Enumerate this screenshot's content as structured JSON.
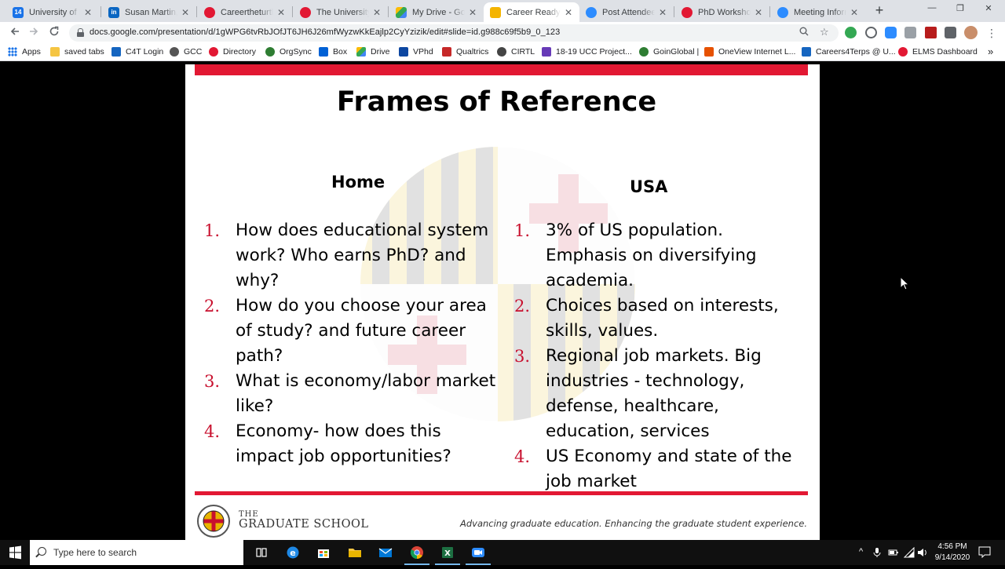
{
  "browser": {
    "tabs": [
      {
        "title": "University of Ma",
        "favicon_color": "#1a73e8",
        "favicon_text": "14"
      },
      {
        "title": "Susan Martin, Ed",
        "favicon_color": "#0a66c2",
        "favicon_text": "in"
      },
      {
        "title": "Careertheturtle",
        "favicon_color": "#e21833",
        "favicon_text": ""
      },
      {
        "title": "The University of",
        "favicon_color": "#e21833",
        "favicon_text": ""
      },
      {
        "title": "My Drive - Goog",
        "favicon_color": "#34a853",
        "favicon_text": ""
      },
      {
        "title": "Career Ready Ti",
        "favicon_color": "#f4b400",
        "favicon_text": ""
      },
      {
        "title": "Post Attendee -",
        "favicon_color": "#2d8cff",
        "favicon_text": ""
      },
      {
        "title": "PhD Workshop",
        "favicon_color": "#e21833",
        "favicon_text": ""
      },
      {
        "title": "Meeting Inform",
        "favicon_color": "#2d8cff",
        "favicon_text": ""
      }
    ],
    "active_tab_index": 5,
    "new_tab_label": "+",
    "window_controls": {
      "minimize": "—",
      "restore": "❐",
      "close": "✕"
    },
    "url": "docs.google.com/presentation/d/1gWPG6tvRbJOfJT6JH6J26mfWyzwKkEajlp2CyYzizik/edit#slide=id.g988c69f5b9_0_123",
    "bookmarks": [
      {
        "label": "Apps",
        "icon": "apps-grid-icon",
        "color": "#1a73e8"
      },
      {
        "label": "saved tabs",
        "icon": "folder-icon",
        "color": "#f5c542"
      },
      {
        "label": "C4T Login",
        "icon": "c4t-icon",
        "color": "#1565c0"
      },
      {
        "label": "GCC",
        "icon": "gcc-icon",
        "color": "#555555"
      },
      {
        "label": "Directory",
        "icon": "umd-icon",
        "color": "#e21833"
      },
      {
        "label": "OrgSync",
        "icon": "orgsync-icon",
        "color": "#2e7d32"
      },
      {
        "label": "Box",
        "icon": "box-icon",
        "color": "#0061d5"
      },
      {
        "label": "Drive",
        "icon": "drive-icon",
        "color": "#34a853"
      },
      {
        "label": "VPhd",
        "icon": "vphd-icon",
        "color": "#0d47a1"
      },
      {
        "label": "Qualtrics",
        "icon": "qualtrics-icon",
        "color": "#c62828"
      },
      {
        "label": "CIRTL",
        "icon": "cirtl-icon",
        "color": "#444444"
      },
      {
        "label": "18-19 UCC Project...",
        "icon": "forms-icon",
        "color": "#673ab7"
      },
      {
        "label": "GoinGlobal |",
        "icon": "goinglobal-icon",
        "color": "#2e7d32"
      },
      {
        "label": "OneView Internet L...",
        "icon": "oneview-icon",
        "color": "#e65100"
      },
      {
        "label": "Careers4Terps @ U...",
        "icon": "careers-icon",
        "color": "#1565c0"
      },
      {
        "label": "ELMS Dashboard",
        "icon": "elms-icon",
        "color": "#e21833"
      }
    ],
    "more_bookmarks": "»"
  },
  "slide": {
    "title": "Frames of Reference",
    "home": {
      "heading": "Home",
      "items": [
        {
          "num": "1.",
          "text": "How does educational system work? Who earns PhD? and why?"
        },
        {
          "num": "2.",
          "text": "How do you choose your area of study? and future career path?"
        },
        {
          "num": "3.",
          "text": "What is economy/labor market like?"
        },
        {
          "num": "4.",
          "text": "Economy- how does this impact job opportunities?"
        }
      ]
    },
    "usa": {
      "heading": "USA",
      "items": [
        {
          "num": "1.",
          "text": "3% of US population. Emphasis on diversifying academia."
        },
        {
          "num": "2.",
          "text": "Choices based on interests, skills, values."
        },
        {
          "num": "3.",
          "text": "Regional job markets. Big industries - technology, defense, healthcare, education, services"
        },
        {
          "num": "4.",
          "text": "US Economy and state of the job market"
        }
      ]
    },
    "footer": {
      "the": "THE",
      "school": "GRADUATE SCHOOL",
      "tagline": "Advancing graduate education. Enhancing the graduate student experience."
    },
    "colors": {
      "accent_red": "#e21833",
      "number_red": "#c8102e"
    }
  },
  "taskbar": {
    "search_placeholder": "Type here to search",
    "apps": [
      "task-view-icon",
      "edge-icon",
      "store-icon",
      "file-explorer-icon",
      "mail-icon",
      "chrome-icon",
      "excel-icon",
      "zoom-icon"
    ],
    "tray_chevron": "^",
    "time": "4:56 PM",
    "date": "9/14/2020"
  }
}
